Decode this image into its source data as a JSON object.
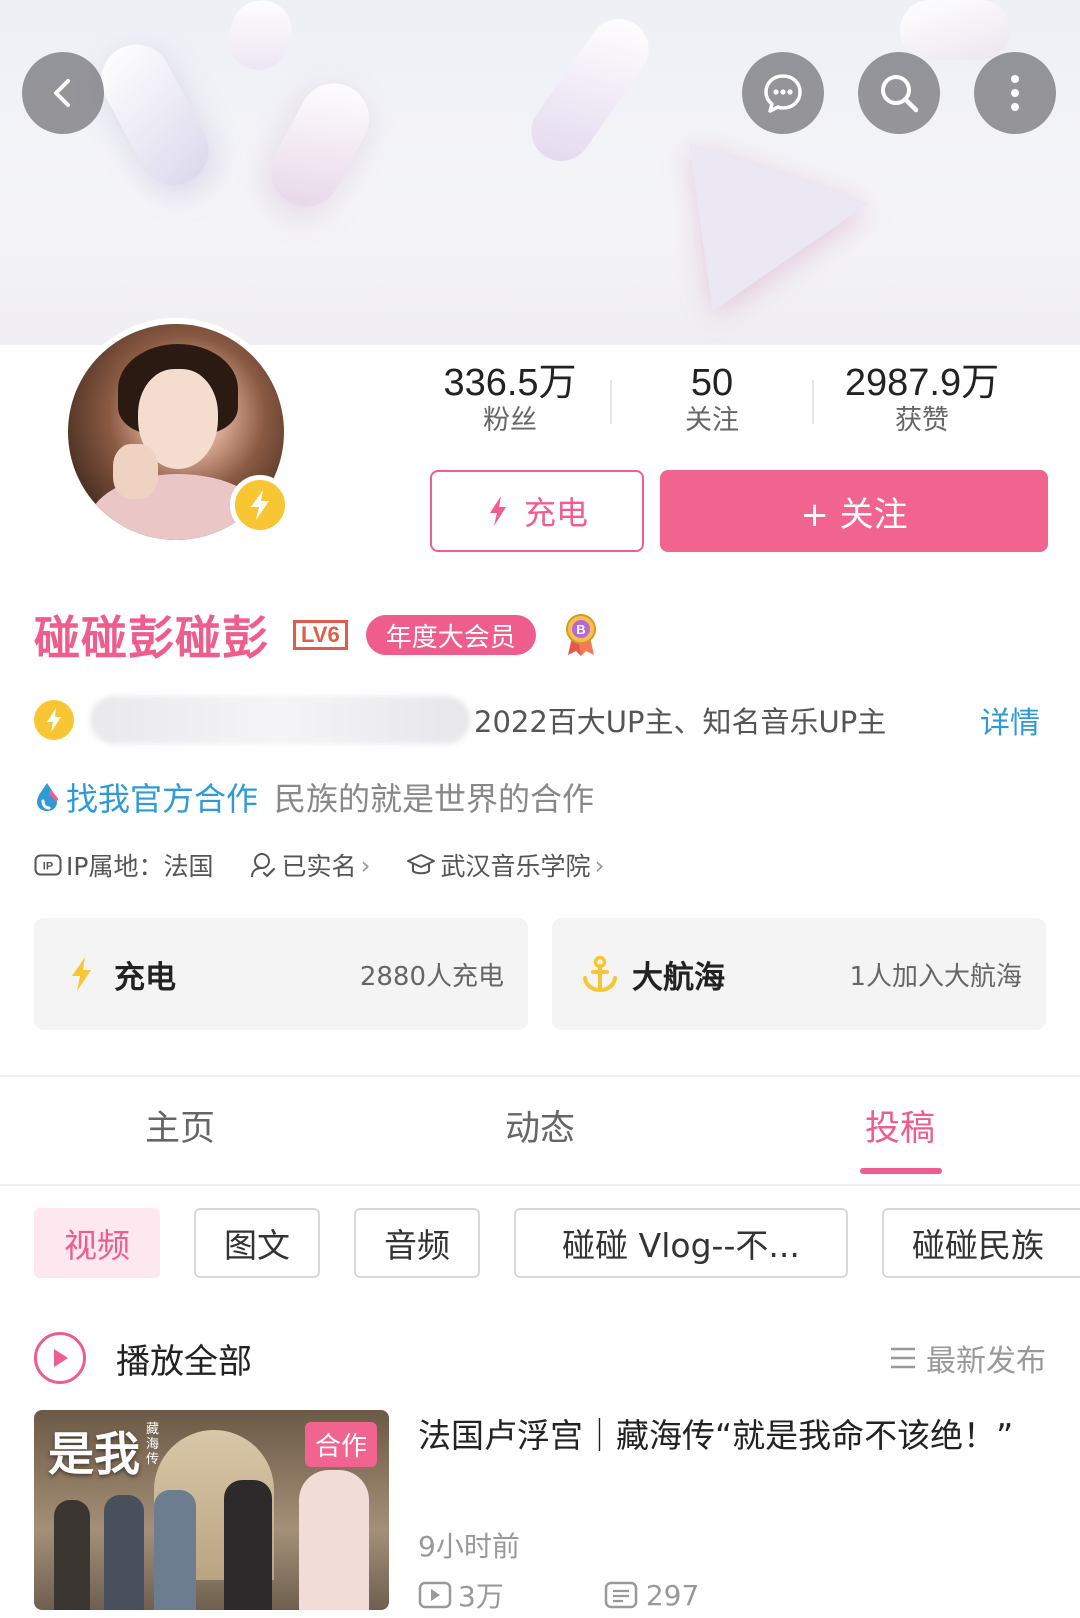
{
  "header": {
    "icons": [
      "back-icon",
      "message-icon",
      "search-icon",
      "more-icon"
    ]
  },
  "profile": {
    "stats": [
      {
        "value": "336.5万",
        "label": "粉丝"
      },
      {
        "value": "50",
        "label": "关注"
      },
      {
        "value": "2987.9万",
        "label": "获赞"
      }
    ],
    "charge_button": "充电",
    "follow_button": "+ 关注",
    "name": "碰碰彭碰彭",
    "level": "LV6",
    "vip_badge": "年度大会员",
    "certification_text": "2022百大UP主、知名音乐UP主",
    "detail_link": "详情",
    "coop_link": "找我官方合作",
    "coop_desc": "民族的就是世界的合作",
    "ip_location": "IP属地：法国",
    "real_name": "已实名",
    "school": "武汉音乐学院"
  },
  "cards": [
    {
      "title": "充电",
      "subtitle": "2880人充电"
    },
    {
      "title": "大航海",
      "subtitle": "1人加入大航海"
    }
  ],
  "tabs": [
    {
      "label": "主页",
      "active": false
    },
    {
      "label": "动态",
      "active": false
    },
    {
      "label": "投稿",
      "active": true
    }
  ],
  "chips": [
    {
      "label": "视频",
      "active": true
    },
    {
      "label": "图文",
      "active": false
    },
    {
      "label": "音频",
      "active": false
    },
    {
      "label": "碰碰 Vlog--不...",
      "active": false
    },
    {
      "label": "碰碰民族",
      "active": false
    }
  ],
  "list": {
    "play_all": "播放全部",
    "sort": "最新发布"
  },
  "videos": [
    {
      "title": "法国卢浮宫｜藏海传“就是我命不该绝！”",
      "thumb_title": "是我",
      "thumb_sub": "藏海传",
      "tag": "合作",
      "time": "9小时前",
      "plays": "3万",
      "comments": "297"
    }
  ],
  "colors": {
    "accent": "#ef5d8d",
    "link": "#2e9bd6",
    "charge_yellow": "#f7c632"
  }
}
